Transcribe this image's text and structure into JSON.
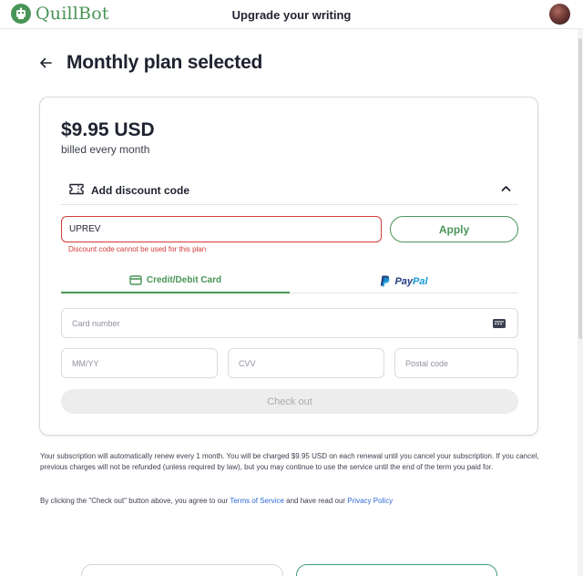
{
  "header": {
    "brand": "QuillBot",
    "title": "Upgrade your writing"
  },
  "page": {
    "title": "Monthly plan selected"
  },
  "plan": {
    "price": "$9.95 USD",
    "billing": "billed every month"
  },
  "discount": {
    "label": "Add discount code",
    "code_value": "UPREV",
    "apply_label": "Apply",
    "error": "Discount code cannot be used for this plan"
  },
  "payment_tabs": {
    "card_label": "Credit/Debit Card",
    "paypal_pay": "Pay",
    "paypal_pal": "Pal",
    "active": "Credit/Debit Card"
  },
  "fields": {
    "card_number_placeholder": "Card number",
    "expiry_placeholder": "MM/YY",
    "cvv_placeholder": "CVV",
    "postal_placeholder": "Postal code"
  },
  "checkout": {
    "label": "Check out",
    "disabled": true
  },
  "legal": {
    "renewal_text": "Your subscription will automatically renew every 1 month. You will be charged $9.95 USD on each renewal until you cancel your subscription. If you cancel, previous charges will not be refunded (unless required by law), but you may continue to use the service until the end of the term you paid for.",
    "agree_prefix": "By clicking the \"Check out\" button above, you agree to our ",
    "terms_link": "Terms of Service",
    "agree_middle": " and have read our ",
    "privacy_link": "Privacy Policy"
  },
  "colors": {
    "brand_green": "#499557",
    "error_red": "#d33a3a",
    "link_blue": "#2d6ad6",
    "paypal_dark": "#253b80",
    "paypal_light": "#179bd7"
  },
  "icons": {
    "logo": "quillbot-robot-icon",
    "back": "arrow-left-icon",
    "discount": "ticket-icon",
    "collapse": "chevron-up-icon",
    "card_tab": "credit-card-icon",
    "paypal": "paypal-icon",
    "card_field": "card-chip-icon"
  }
}
